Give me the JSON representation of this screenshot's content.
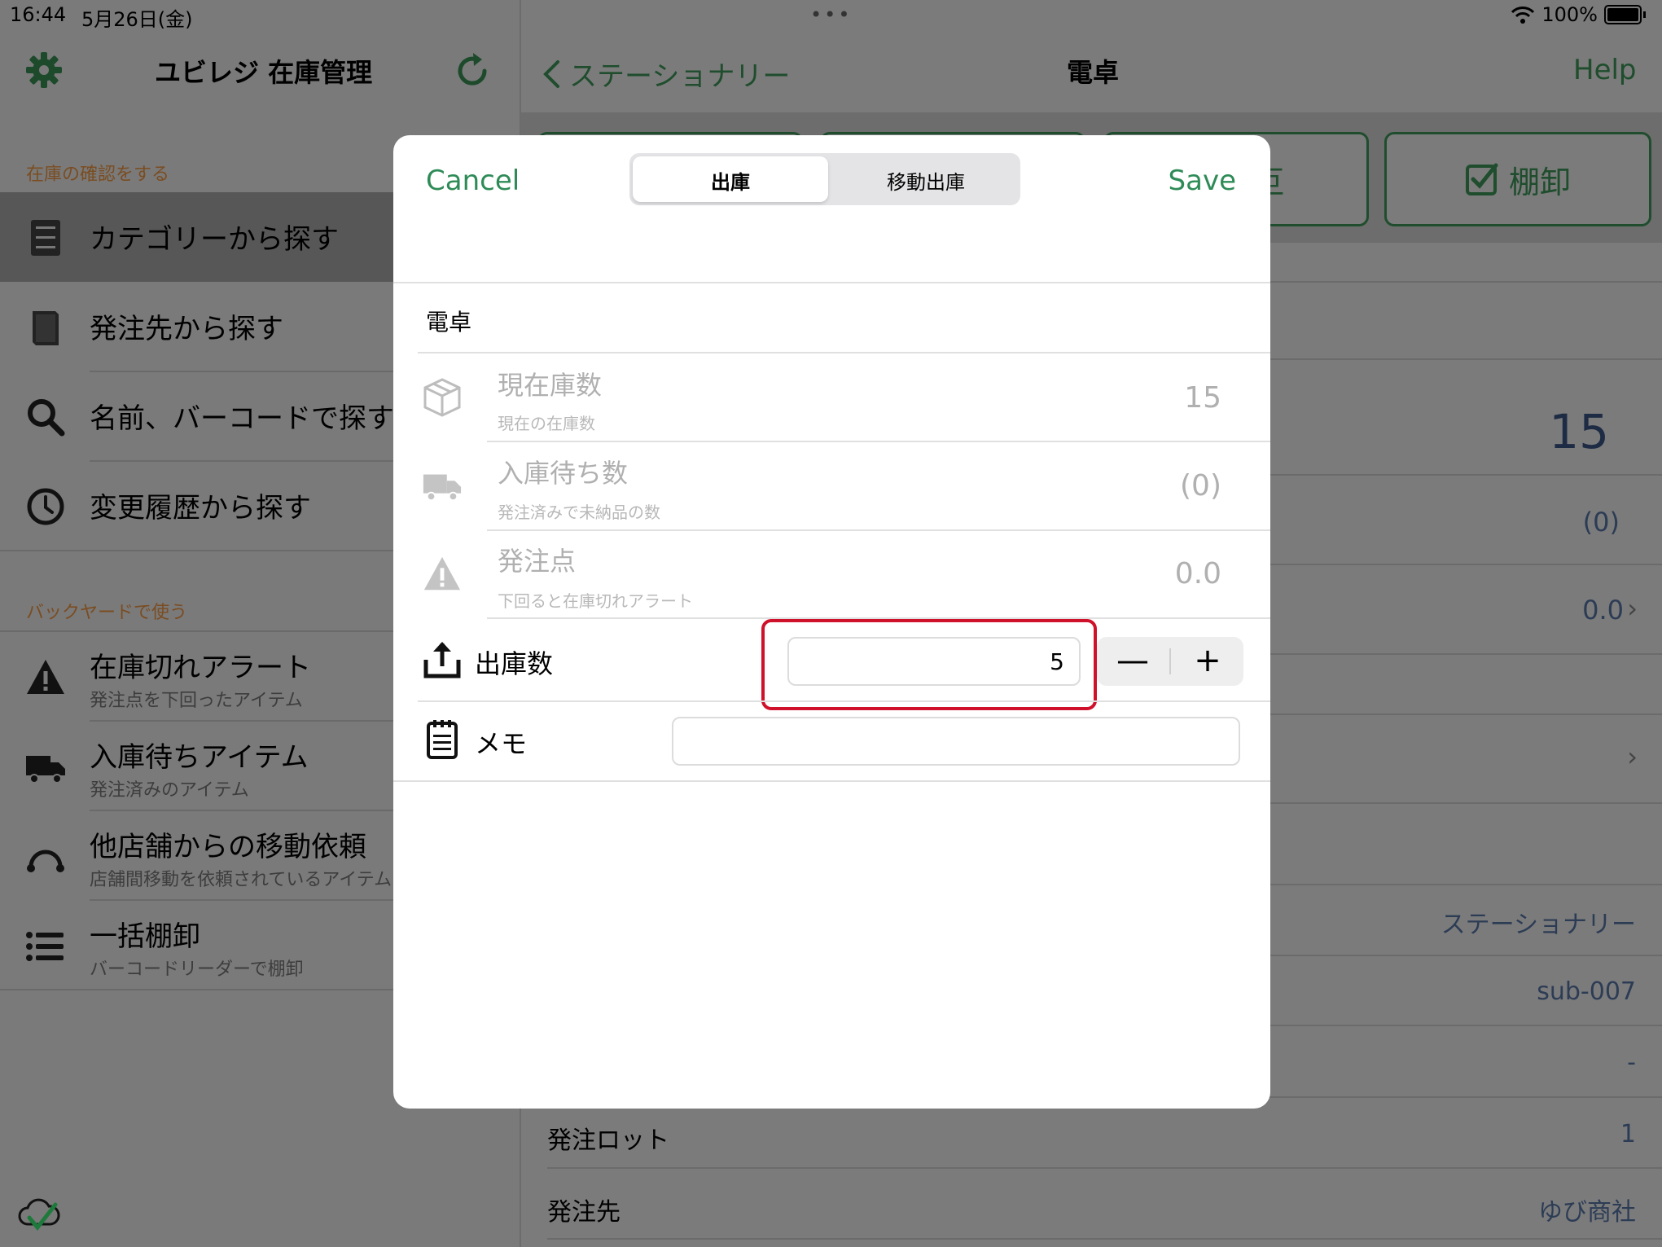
{
  "status_bar": {
    "time": "16:44",
    "date": "5月26日(金)",
    "dots": "•••",
    "battery": "100%"
  },
  "sidebar": {
    "title": "ユビレジ 在庫管理",
    "section1": "在庫の確認をする",
    "section2": "バックヤードで使う",
    "items": [
      {
        "label": "カテゴリーから探す",
        "selected": true
      },
      {
        "label": "発注先から探す"
      },
      {
        "label": "名前、バーコードで探す"
      },
      {
        "label": "変更履歴から探す"
      }
    ],
    "backyard": [
      {
        "label": "在庫切れアラート",
        "sub": "発注点を下回ったアイテム"
      },
      {
        "label": "入庫待ちアイテム",
        "sub": "発注済みのアイテム"
      },
      {
        "label": "他店舗からの移動依頼",
        "sub": "店舗間移動を依頼されているアイテム"
      },
      {
        "label": "一括棚卸",
        "sub": "バーコードリーダーで棚卸"
      }
    ]
  },
  "detail": {
    "back_label": "ステーショナリー",
    "title": "電卓",
    "help": "Help",
    "toolbar_partial": "叵",
    "toolbar_inventory": "棚卸",
    "stock_big": "15",
    "waiting": "(0)",
    "reorder": "0.0",
    "chevron": "›",
    "category": "ステーショナリー",
    "code": "sub-007",
    "dash": "-",
    "lot_label": "発注ロット",
    "lot_value": "1",
    "supplier_label": "発注先",
    "supplier_value": "ゆび商社"
  },
  "modal": {
    "cancel": "Cancel",
    "save": "Save",
    "segments": [
      "出庫",
      "移動出庫"
    ],
    "item_name": "電卓",
    "rows": [
      {
        "label": "現在庫数",
        "sub": "現在の在庫数",
        "value": "15"
      },
      {
        "label": "入庫待ち数",
        "sub": "発注済みで未納品の数",
        "value": "(0)"
      },
      {
        "label": "発注点",
        "sub": "下回ると在庫切れアラート",
        "value": "0.0"
      }
    ],
    "out_label": "出庫数",
    "out_value": "5",
    "minus": "—",
    "plus": "+",
    "memo_label": "メモ",
    "memo_value": ""
  },
  "colors": {
    "accent": "#2e8b57",
    "highlight": "#d0112b",
    "section_label": "#b06a2c"
  }
}
